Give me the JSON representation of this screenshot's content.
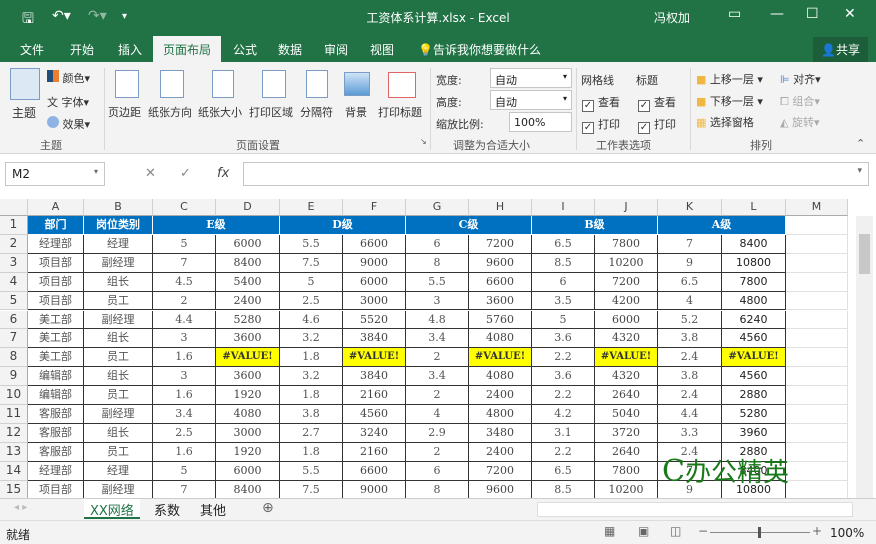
{
  "titlebar": {
    "title": "工资体系计算.xlsx - Excel",
    "user": "冯权加",
    "save_icon": "save-icon",
    "undo_icon": "undo-icon",
    "redo_icon": "redo-icon"
  },
  "tabs": [
    {
      "label": "文件"
    },
    {
      "label": "开始"
    },
    {
      "label": "插入"
    },
    {
      "label": "页面布局",
      "active": true
    },
    {
      "label": "公式"
    },
    {
      "label": "数据"
    },
    {
      "label": "审阅"
    },
    {
      "label": "视图"
    }
  ],
  "tell_me": "告诉我你想要做什么",
  "share": "共享",
  "ribbon": {
    "themes": {
      "theme": "主题",
      "colors": "颜色",
      "fonts": "字体",
      "effects": "效果",
      "group": "主题"
    },
    "page_setup": {
      "margins": "页边距",
      "orientation": "纸张方向",
      "size": "纸张大小",
      "print_area": "打印区域",
      "breaks": "分隔符",
      "background": "背景",
      "print_titles": "打印标题",
      "group": "页面设置"
    },
    "scale": {
      "width_label": "宽度:",
      "width_value": "自动",
      "height_label": "高度:",
      "height_value": "自动",
      "scale_label": "缩放比例:",
      "scale_value": "100%",
      "group": "调整为合适大小"
    },
    "sheet_options": {
      "gridlines": "网格线",
      "headings": "标题",
      "view": "查看",
      "print": "打印",
      "group": "工作表选项"
    },
    "arrange": {
      "bring_forward": "上移一层",
      "send_backward": "下移一层",
      "selection_pane": "选择窗格",
      "align": "对齐",
      "group_btn": "组合",
      "rotate": "旋转",
      "group": "排列"
    }
  },
  "formula_bar": {
    "name_box": "M2",
    "fx": "fx",
    "formula": ""
  },
  "columns": [
    "A",
    "B",
    "C",
    "D",
    "E",
    "F",
    "G",
    "H",
    "I",
    "J",
    "K",
    "L",
    "M"
  ],
  "header_row": {
    "dept": "部门",
    "position": "岗位类别",
    "grades": [
      "E级",
      "D级",
      "C级",
      "B级",
      "A级"
    ]
  },
  "rows": [
    [
      "经理部",
      "经理",
      "5",
      "6000",
      "5.5",
      "6600",
      "6",
      "7200",
      "6.5",
      "7800",
      "7",
      "8400"
    ],
    [
      "项目部",
      "副经理",
      "7",
      "8400",
      "7.5",
      "9000",
      "8",
      "9600",
      "8.5",
      "10200",
      "9",
      "10800"
    ],
    [
      "项目部",
      "组长",
      "4.5",
      "5400",
      "5",
      "6000",
      "5.5",
      "6600",
      "6",
      "7200",
      "6.5",
      "7800"
    ],
    [
      "项目部",
      "员工",
      "2",
      "2400",
      "2.5",
      "3000",
      "3",
      "3600",
      "3.5",
      "4200",
      "4",
      "4800"
    ],
    [
      "美工部",
      "副经理",
      "4.4",
      "5280",
      "4.6",
      "5520",
      "4.8",
      "5760",
      "5",
      "6000",
      "5.2",
      "6240"
    ],
    [
      "美工部",
      "组长",
      "3",
      "3600",
      "3.2",
      "3840",
      "3.4",
      "4080",
      "3.6",
      "4320",
      "3.8",
      "4560"
    ],
    [
      "美工部",
      "员工",
      "1.6",
      "#VALUE!",
      "1.8",
      "#VALUE!",
      "2",
      "#VALUE!",
      "2.2",
      "#VALUE!",
      "2.4",
      "#VALUE!"
    ],
    [
      "编辑部",
      "组长",
      "3",
      "3600",
      "3.2",
      "3840",
      "3.4",
      "4080",
      "3.6",
      "4320",
      "3.8",
      "4560"
    ],
    [
      "编辑部",
      "员工",
      "1.6",
      "1920",
      "1.8",
      "2160",
      "2",
      "2400",
      "2.2",
      "2640",
      "2.4",
      "2880"
    ],
    [
      "客服部",
      "副经理",
      "3.4",
      "4080",
      "3.8",
      "4560",
      "4",
      "4800",
      "4.2",
      "5040",
      "4.4",
      "5280"
    ],
    [
      "客服部",
      "组长",
      "2.5",
      "3000",
      "2.7",
      "3240",
      "2.9",
      "3480",
      "3.1",
      "3720",
      "3.3",
      "3960"
    ],
    [
      "客服部",
      "员工",
      "1.6",
      "1920",
      "1.8",
      "2160",
      "2",
      "2400",
      "2.2",
      "2640",
      "2.4",
      "2880"
    ],
    [
      "经理部",
      "经理",
      "5",
      "6000",
      "5.5",
      "6600",
      "6",
      "7200",
      "6.5",
      "7800",
      "7",
      "8400"
    ],
    [
      "项目部",
      "副经理",
      "7",
      "8400",
      "7.5",
      "9000",
      "8",
      "9600",
      "8.5",
      "10200",
      "9",
      "10800"
    ]
  ],
  "sheets": [
    {
      "label": "XX网络",
      "active": true
    },
    {
      "label": "系数"
    },
    {
      "label": "其他"
    }
  ],
  "status": {
    "ready": "就绪",
    "zoom": "100%"
  },
  "watermark": "办公精英",
  "colors": {
    "excel_green": "#217346",
    "header_blue": "#0070c0",
    "error_yellow": "#ffff00"
  }
}
